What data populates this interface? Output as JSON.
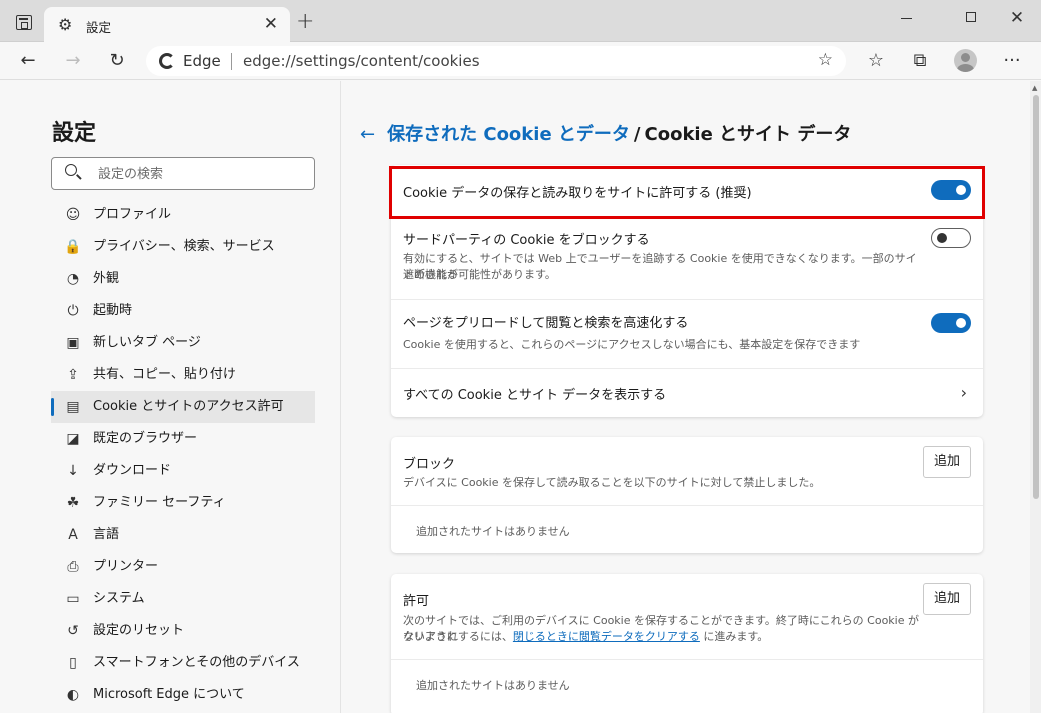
{
  "window": {
    "tab_title": "設定",
    "tab_icon": "gear-icon",
    "close_tab": "✕",
    "new_tab": "+",
    "minimize": "—",
    "close_window": "✕"
  },
  "address_bar": {
    "brand": "Edge",
    "url": "edge://settings/content/cookies"
  },
  "sidebar": {
    "title": "設定",
    "search_placeholder": "設定の検索",
    "items": [
      {
        "label": "プロファイル",
        "icon": "profile-icon",
        "glyph": "☺"
      },
      {
        "label": "プライバシー、検索、サービス",
        "icon": "lock-icon",
        "glyph": "🔒"
      },
      {
        "label": "外観",
        "icon": "palette-icon",
        "glyph": "◔"
      },
      {
        "label": "起動時",
        "icon": "power-icon",
        "glyph": "⏻"
      },
      {
        "label": "新しいタブ ページ",
        "icon": "new-tab-page-icon",
        "glyph": "▣"
      },
      {
        "label": "共有、コピー、貼り付け",
        "icon": "share-icon",
        "glyph": "⇪"
      },
      {
        "label": "Cookie とサイトのアクセス許可",
        "icon": "site-permissions-icon",
        "glyph": "▤",
        "active": true
      },
      {
        "label": "既定のブラウザー",
        "icon": "default-browser-icon",
        "glyph": "◪"
      },
      {
        "label": "ダウンロード",
        "icon": "download-icon",
        "glyph": "↓"
      },
      {
        "label": "ファミリー セーフティ",
        "icon": "family-icon",
        "glyph": "☘"
      },
      {
        "label": "言語",
        "icon": "language-icon",
        "glyph": "A"
      },
      {
        "label": "プリンター",
        "icon": "printer-icon",
        "glyph": "⎙"
      },
      {
        "label": "システム",
        "icon": "system-icon",
        "glyph": "▭"
      },
      {
        "label": "設定のリセット",
        "icon": "reset-icon",
        "glyph": "↺"
      },
      {
        "label": "スマートフォンとその他のデバイス",
        "icon": "phone-icon",
        "glyph": "▯"
      },
      {
        "label": "Microsoft Edge について",
        "icon": "edge-logo-icon",
        "glyph": "◐"
      }
    ]
  },
  "breadcrumb": {
    "back_glyph": "←",
    "parent": "保存された Cookie とデータ",
    "separator": "/",
    "current": "Cookie とサイト データ"
  },
  "settings_card": {
    "allow_row": {
      "title": "Cookie データの保存と読み取りをサイトに許可する (推奨)",
      "toggle": "on"
    },
    "third_party_row": {
      "title": "サードパーティの Cookie をブロックする",
      "desc_line1": "有効にすると、サイトでは Web 上でユーザーを追跡する Cookie を使用できなくなります。一部のサイトの機能が",
      "desc_line2": "遮断される可能性があります。",
      "toggle": "off"
    },
    "preload_row": {
      "title": "ページをプリロードして閲覧と検索を高速化する",
      "desc": "Cookie を使用すると、これらのページにアクセスしない場合にも、基本設定を保存できます",
      "toggle": "on"
    },
    "see_all_row": {
      "title": "すべての Cookie とサイト データを表示する",
      "chevron": "›"
    }
  },
  "block_card": {
    "title": "ブロック",
    "desc": "デバイスに Cookie を保存して読み取ることを以下のサイトに対して禁止しました。",
    "add_label": "追加",
    "empty": "追加されたサイトはありません"
  },
  "allow_card": {
    "title": "許可",
    "desc_line1": "次のサイトでは、ご利用のデバイスに Cookie を保存することができます。終了時にこれらの Cookie がクリアされ",
    "desc_line2_pre": "ないようにするには、",
    "desc_link": "閉じるときに閲覧データをクリアする",
    "desc_line2_post": " に進みます。",
    "add_label": "追加",
    "empty": "追加されたサイトはありません"
  },
  "colors": {
    "accent": "#0f6cbd",
    "highlight_border": "#e00000"
  }
}
